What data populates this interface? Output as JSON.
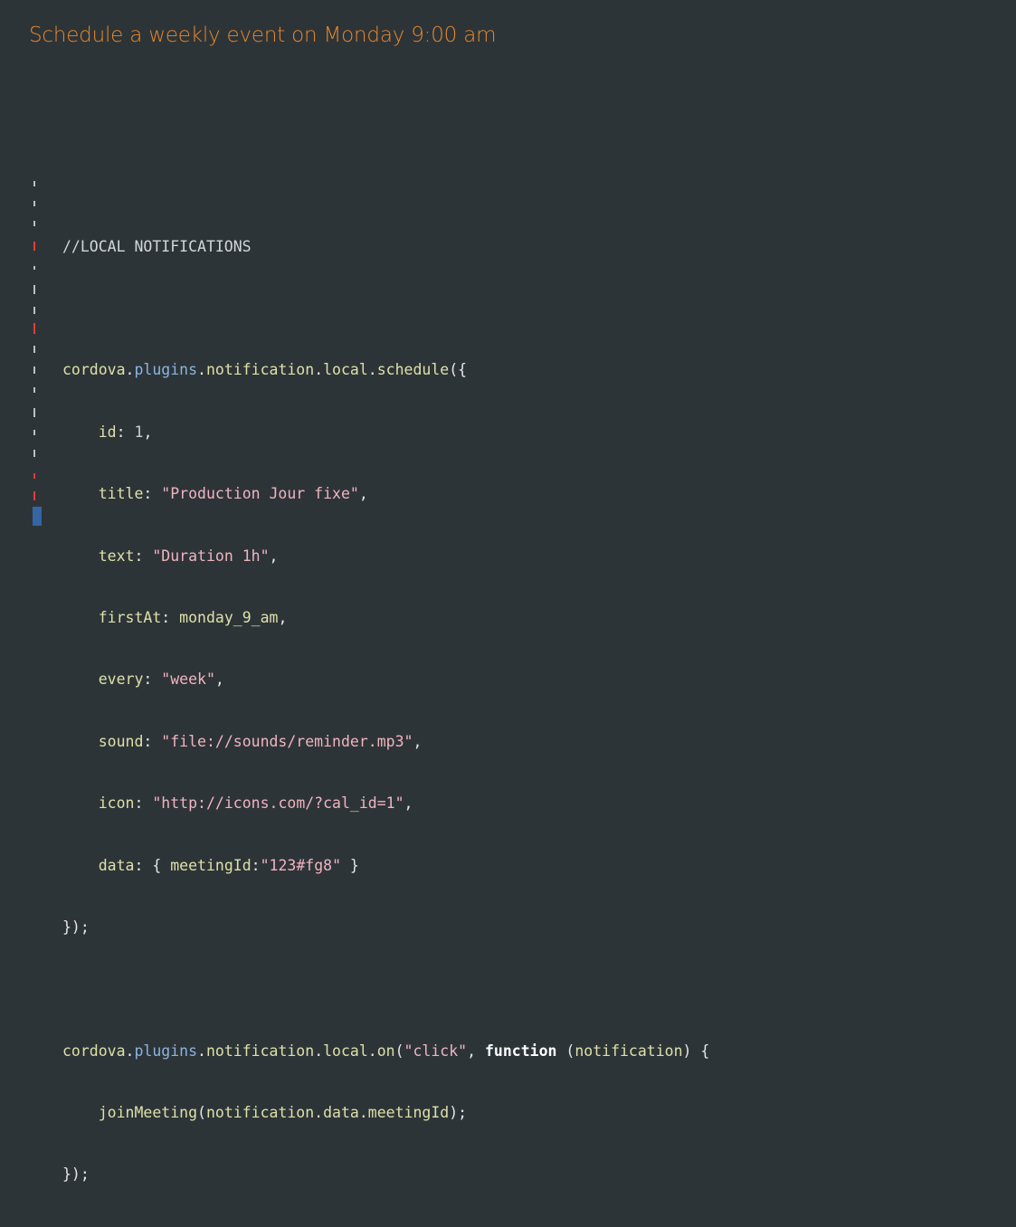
{
  "header": {
    "title": "Schedule a weekly event on Monday 9:00 am"
  },
  "code": {
    "comment": "//LOCAL NOTIFICATIONS",
    "schedule": {
      "obj": "cordova",
      "p1": "plugins",
      "p2": "notification",
      "p3": "local",
      "method": "schedule",
      "open": "({",
      "id_key": "id",
      "id_val": "1",
      "title_key": "title",
      "title_val": "\"Production Jour fixe\"",
      "text_key": "text",
      "text_val": "\"Duration 1h\"",
      "firstAt_key": "firstAt",
      "firstAt_val": "monday_9_am",
      "every_key": "every",
      "every_val": "\"week\"",
      "sound_key": "sound",
      "sound_val": "\"file://sounds/reminder.mp3\"",
      "icon_key": "icon",
      "icon_val": "\"http://icons.com/?cal_id=1\"",
      "data_key": "data",
      "meeting_key": "meetingId",
      "meeting_val": "\"123#fg8\"",
      "close": "});"
    },
    "on": {
      "obj": "cordova",
      "p1": "plugins",
      "p2": "notification",
      "p3": "local",
      "method": "on",
      "event": "\"click\"",
      "keyword": "function",
      "param": "notification",
      "call": "joinMeeting",
      "arg": "notification.data.meetingId",
      "close": "});"
    }
  },
  "colors": {
    "background": "#2d3437",
    "title": "#e5882e",
    "string": "#f0b4c0",
    "property": "#8ab4e0",
    "identifier": "#dde0a9"
  }
}
